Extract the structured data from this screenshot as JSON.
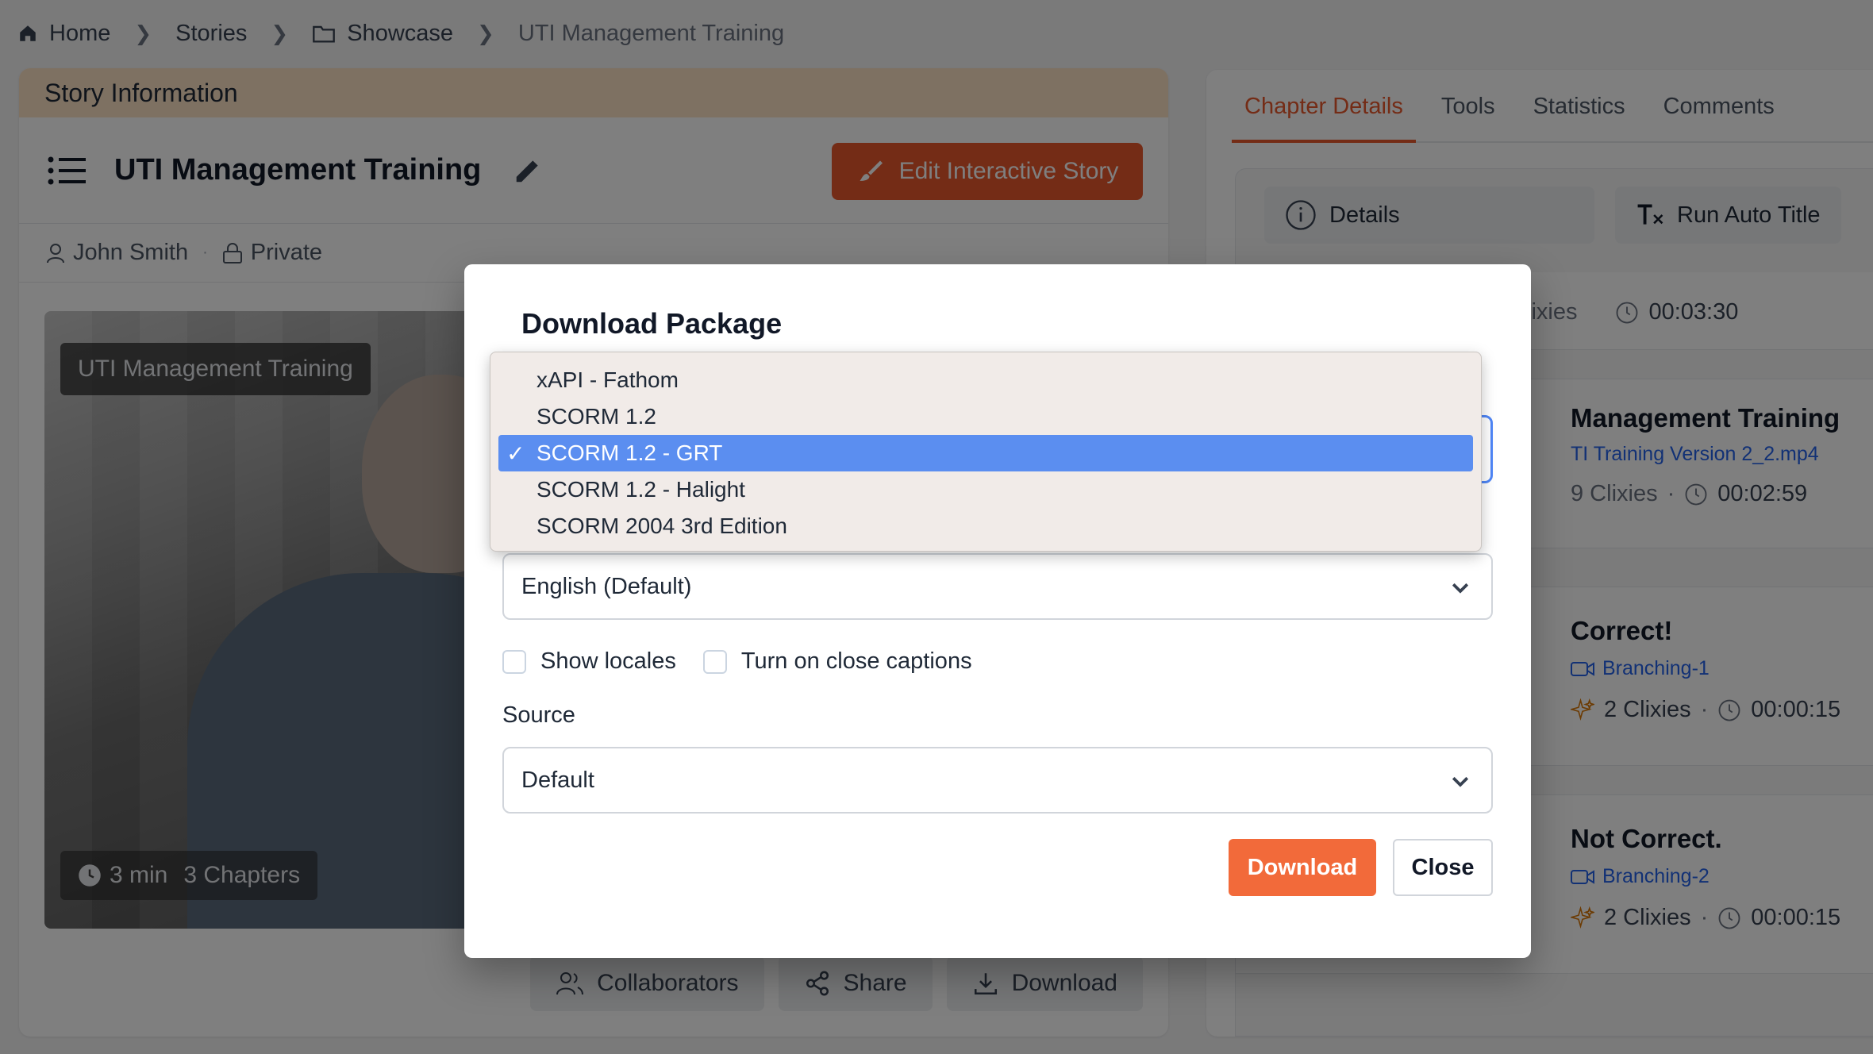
{
  "breadcrumb": {
    "home": "Home",
    "stories": "Stories",
    "showcase": "Showcase",
    "current": "UTI Management Training"
  },
  "story": {
    "section_header": "Story Information",
    "title": "UTI Management Training",
    "edit_label": "Edit Interactive Story",
    "author": "John Smith",
    "visibility": "Private",
    "thumb_title": "UTI Management Training",
    "duration": "3 min",
    "chapters": "3 Chapters",
    "actions": {
      "collaborators": "Collaborators",
      "share": "Share",
      "download": "Download"
    }
  },
  "right": {
    "tabs": [
      "Chapter Details",
      "Tools",
      "Statistics",
      "Comments"
    ],
    "subtabs": {
      "details": "Details",
      "auto_title": "Run Auto Title"
    },
    "summary": {
      "clixies_partial": "lixies",
      "time": "00:03:30"
    },
    "chapters": [
      {
        "title": "Management Training",
        "link": "TI Training Version 2_2.mp4",
        "clixies": "9 Clixies",
        "time": "00:02:59"
      },
      {
        "title": "Correct!",
        "link": "Branching-1",
        "clixies": "2 Clixies",
        "time": "00:00:15"
      },
      {
        "title": "Not Correct.",
        "link": "Branching-2",
        "clixies": "2 Clixies",
        "time": "00:00:15"
      }
    ]
  },
  "modal": {
    "title": "Download Package",
    "format_options": [
      "xAPI - Fathom",
      "SCORM 1.2",
      "SCORM 1.2 - GRT",
      "SCORM 1.2 - Halight",
      "SCORM 2004 3rd Edition"
    ],
    "selected_check": "✓",
    "language_value": "English (Default)",
    "show_locales": "Show locales",
    "captions": "Turn on close captions",
    "source_label": "Source",
    "source_value": "Default",
    "download_label": "Download",
    "close_label": "Close"
  },
  "colors": {
    "accent": "#e8582c",
    "selected": "#5b8ef0",
    "link": "#2563eb"
  }
}
